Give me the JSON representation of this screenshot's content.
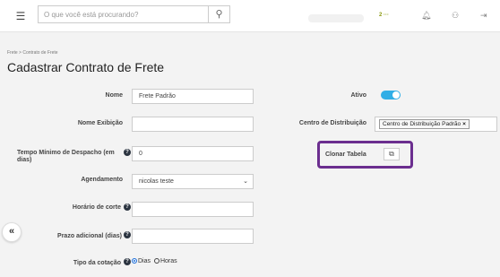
{
  "header": {
    "menu_icon": "hamburger-icon",
    "search": {
      "placeholder": "O que você está procurando?",
      "value": ""
    },
    "badge_text": "2 ···",
    "icons": [
      "bell-icon",
      "users-icon",
      "logout-icon"
    ]
  },
  "page": {
    "breadcrumb": "Frete > Contrato de Frete",
    "title": "Cadastrar Contrato de Frete"
  },
  "form": {
    "nome": {
      "label": "Nome",
      "value": "Frete Padrão"
    },
    "nome_exibicao": {
      "label": "Nome Exibição",
      "value": ""
    },
    "tempo_minimo": {
      "label": "Tempo Mínimo de Despacho (em dias)",
      "value": "0"
    },
    "agendamento": {
      "label": "Agendamento",
      "value": "nicolas teste"
    },
    "horario_corte": {
      "label": "Horário de corte",
      "value": ""
    },
    "prazo_adicional": {
      "label": "Prazo adicional (dias)",
      "value": ""
    },
    "tipo_cotacao": {
      "label": "Tipo da cotação",
      "options": [
        "Dias",
        "Horas"
      ],
      "selected": "Dias"
    },
    "ativo": {
      "label": "Ativo",
      "on": true
    },
    "centro_distribuicao": {
      "label": "Centro de Distribuição",
      "chip": "Centro de Distribuição Padrão",
      "chip_remove": "×"
    },
    "clonar_tabela": {
      "label": "Clonar Tabela",
      "icon": "copy-icon"
    }
  },
  "colors": {
    "accent": "#30aee6",
    "highlight": "#6b2e8f",
    "radio": "#1e6fd9"
  },
  "sidebar_toggle": {
    "label": "«"
  }
}
